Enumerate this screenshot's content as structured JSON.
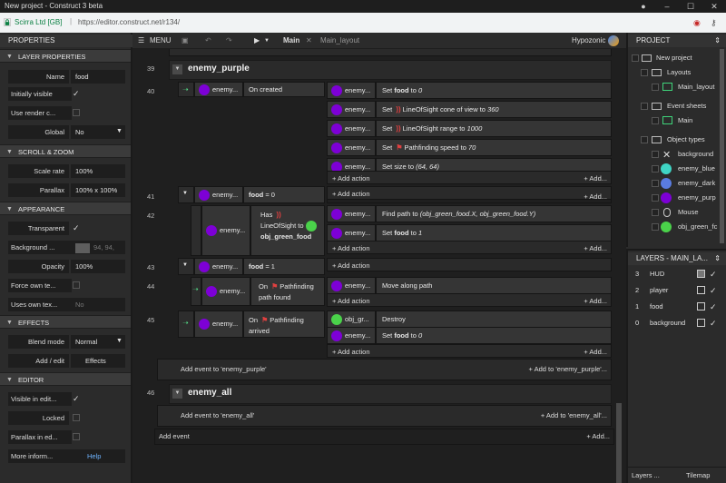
{
  "window": {
    "title": "New project - Construct 3 beta"
  },
  "urlbar": {
    "org": "Scirra Ltd [GB]",
    "separator": "|",
    "url": "https://editor.construct.net/r134/"
  },
  "properties": {
    "title": "PROPERTIES",
    "sections": {
      "layer": "LAYER PROPERTIES",
      "scroll": "SCROLL & ZOOM",
      "appearance": "APPEARANCE",
      "effects": "EFFECTS",
      "editor": "EDITOR"
    },
    "rows": {
      "name": {
        "label": "Name",
        "value": "food"
      },
      "initially_visible": {
        "label": "Initially visible"
      },
      "use_render": {
        "label": "Use render c..."
      },
      "global": {
        "label": "Global",
        "value": "No"
      },
      "scale_rate": {
        "label": "Scale rate",
        "value": "100%"
      },
      "parallax": {
        "label": "Parallax",
        "value": "100% x 100%"
      },
      "transparent": {
        "label": "Transparent"
      },
      "background": {
        "label": "Background ...",
        "value": "94, 94,"
      },
      "opacity": {
        "label": "Opacity",
        "value": "100%"
      },
      "force_own": {
        "label": "Force own te..."
      },
      "uses_own": {
        "label": "Uses own tex...",
        "value": "No"
      },
      "blend_mode": {
        "label": "Blend mode",
        "value": "Normal"
      },
      "add_edit": {
        "label": "Add / edit",
        "value": "Effects"
      },
      "visible_in_editor": {
        "label": "Visible in edit..."
      },
      "locked": {
        "label": "Locked"
      },
      "parallax_editor": {
        "label": "Parallax in ed..."
      },
      "more_info": {
        "label": "More inform...",
        "value": "Help"
      }
    }
  },
  "toolbar": {
    "menu": "MENU",
    "tab_main": "Main",
    "tab_layout": "Main_layout",
    "user": "Hypozonic"
  },
  "sheet": {
    "group1": {
      "line": "39",
      "title": "enemy_purple"
    },
    "e40": {
      "line": "40",
      "obj": "enemy...",
      "cond": "On created",
      "actions": [
        {
          "obj": "enemy...",
          "pre": "Set ",
          "bold": "food",
          "mid": " to ",
          "it": "0"
        },
        {
          "obj": "enemy...",
          "pre": "Set ",
          "sig": true,
          "mid": "LineOfSight cone of view to ",
          "it": "360"
        },
        {
          "obj": "enemy...",
          "pre": "Set ",
          "sig": true,
          "mid": "LineOfSight range to ",
          "it": "1000"
        },
        {
          "obj": "enemy...",
          "pre": "Set ",
          "pf": true,
          "mid": "Pathfinding speed to ",
          "it": "70"
        },
        {
          "obj": "enemy...",
          "pre": "Set size to ",
          "it": "(64, 64)"
        }
      ]
    },
    "e41": {
      "line": "41",
      "obj": "enemy...",
      "cond_bold": "food",
      "cond_rest": " = 0"
    },
    "e42": {
      "line": "42",
      "obj": "enemy...",
      "cond_has": "Has",
      "cond_los": "LineOfSight to",
      "cond_target": "obj_green_food",
      "actions": [
        {
          "obj": "enemy...",
          "pre": "Find path to ",
          "it": "(obj_green_food.X, obj_green_food.Y)"
        },
        {
          "obj": "enemy...",
          "pre": "Set ",
          "bold": "food",
          "mid": " to ",
          "it": "1"
        }
      ]
    },
    "e43": {
      "line": "43",
      "obj": "enemy...",
      "cond_bold": "food",
      "cond_rest": " = 1"
    },
    "e44": {
      "line": "44",
      "obj": "enemy...",
      "cond_on": "On",
      "cond_pf": "Pathfinding",
      "cond_rest": "path found",
      "action_obj": "enemy...",
      "action": "Move along path"
    },
    "e45": {
      "line": "45",
      "obj": "enemy...",
      "cond_on": "On",
      "cond_pf": "Pathfinding",
      "cond_rest": "arrived",
      "actions": [
        {
          "obj": "obj_gr...",
          "pre": "Destroy"
        },
        {
          "obj": "enemy...",
          "pre": "Set ",
          "bold": "food",
          "mid": " to ",
          "it": "0"
        }
      ]
    },
    "add_action": "+ Add action",
    "add_more": "+ Add...",
    "add_event_purple": "Add event to 'enemy_purple'",
    "add_to_purple": "+ Add to 'enemy_purple'...",
    "group2": {
      "line": "46",
      "title": "enemy_all"
    },
    "add_event_all": "Add event to 'enemy_all'",
    "add_to_all": "+ Add to 'enemy_all'...",
    "add_event": "Add event",
    "add_event_more": "+ Add..."
  },
  "project": {
    "title": "PROJECT",
    "items": {
      "root": "New project",
      "layouts": "Layouts",
      "main_layout": "Main_layout",
      "event_sheets": "Event sheets",
      "main": "Main",
      "object_types": "Object types",
      "o1": "background",
      "o2": "enemy_blue",
      "o3": "enemy_dark",
      "o4": "enemy_purp",
      "o5": "Mouse",
      "o6": "obj_green_fc"
    }
  },
  "layers": {
    "title": "LAYERS - MAIN_LA...",
    "rows": [
      {
        "idx": "3",
        "name": "HUD"
      },
      {
        "idx": "2",
        "name": "player"
      },
      {
        "idx": "1",
        "name": "food"
      },
      {
        "idx": "0",
        "name": "background"
      }
    ],
    "tab_layers": "Layers ...",
    "tab_tilemap": "Tilemap"
  }
}
